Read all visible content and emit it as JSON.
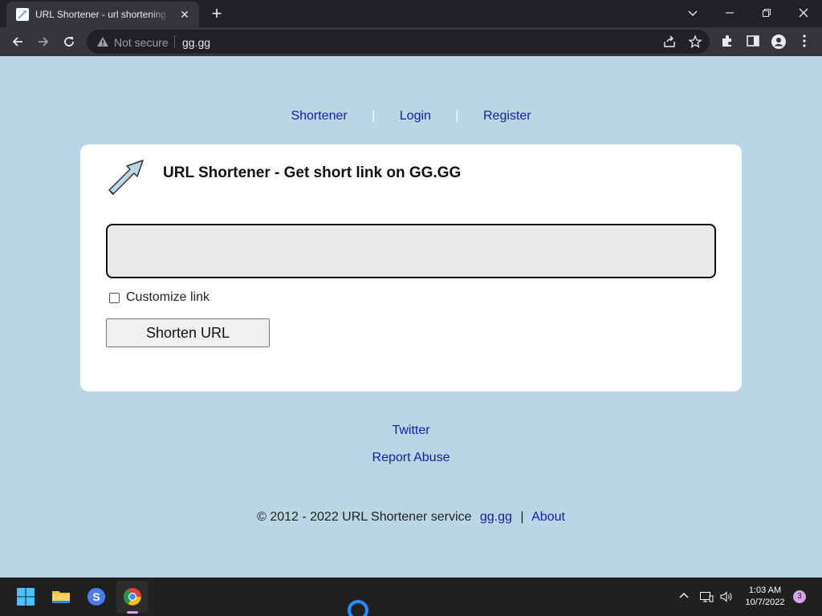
{
  "browser": {
    "tab_title": "URL Shortener - url shortening service",
    "security_label": "Not secure",
    "url": "gg.gg"
  },
  "nav": {
    "items": [
      {
        "label": "Shortener"
      },
      {
        "label": "Login"
      },
      {
        "label": "Register"
      }
    ],
    "separator": "|"
  },
  "card": {
    "title": "URL Shortener - Get short link on GG.GG",
    "url_input": {
      "value": "",
      "placeholder": ""
    },
    "customize_label": "Customize link",
    "customize_checked": false,
    "shorten_button": "Shorten URL"
  },
  "footer": {
    "twitter": "Twitter",
    "report_abuse": "Report Abuse",
    "copyright": "© 2012 - 2022 URL Shortener service",
    "site_link": "gg.gg",
    "separator": "|",
    "about": "About"
  },
  "taskbar": {
    "time": "1:03 AM",
    "date": "10/7/2022",
    "notification_count": "3"
  },
  "colors": {
    "page_background": "#b8d6e3",
    "link": "#1a1aa6",
    "card": "#ffffff",
    "chrome_dark": "#202124",
    "chrome_toolbar": "#35363a"
  }
}
